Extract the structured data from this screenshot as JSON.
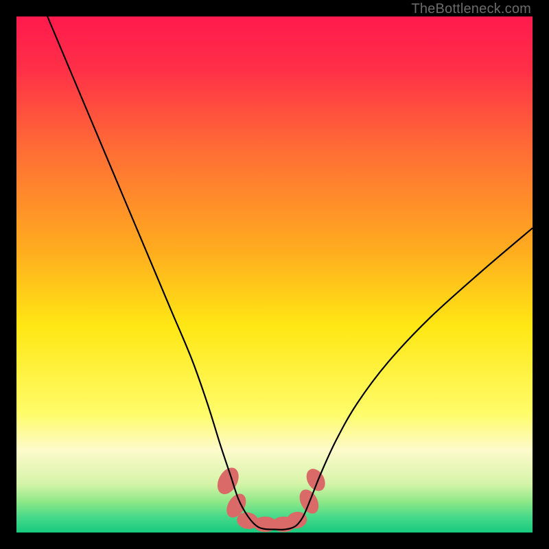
{
  "watermark": "TheBottleneck.com",
  "chart_data": {
    "type": "line",
    "title": "",
    "xlabel": "",
    "ylabel": "",
    "xlim": [
      0,
      100
    ],
    "ylim": [
      0,
      100
    ],
    "background_gradient": {
      "stops": [
        {
          "offset": 0.0,
          "color": "#ff1a4d"
        },
        {
          "offset": 0.1,
          "color": "#ff2f48"
        },
        {
          "offset": 0.25,
          "color": "#ff6a36"
        },
        {
          "offset": 0.45,
          "color": "#ffab1f"
        },
        {
          "offset": 0.6,
          "color": "#ffe714"
        },
        {
          "offset": 0.77,
          "color": "#fffc6a"
        },
        {
          "offset": 0.84,
          "color": "#fdfacb"
        },
        {
          "offset": 0.905,
          "color": "#d6f4a9"
        },
        {
          "offset": 0.94,
          "color": "#8fe887"
        },
        {
          "offset": 0.97,
          "color": "#46d98a"
        },
        {
          "offset": 1.0,
          "color": "#17c97d"
        }
      ]
    },
    "series": [
      {
        "name": "bottleneck-curve",
        "color": "#000000",
        "stroke_width": 2.2,
        "x": [
          6,
          10,
          14,
          18,
          22,
          26,
          30,
          34,
          37,
          39.5,
          41.5,
          43,
          44.8,
          46.5,
          48,
          50,
          52,
          54,
          55.5,
          57,
          59,
          62,
          66,
          72,
          80,
          90,
          100
        ],
        "y": [
          100,
          90.5,
          81,
          71.5,
          62,
          52.5,
          43,
          33.5,
          25,
          17,
          11,
          6.5,
          3.2,
          1.3,
          0.7,
          0.6,
          0.6,
          1.2,
          3.0,
          6.5,
          11.5,
          18,
          25,
          33,
          41.5,
          50.5,
          59
        ]
      }
    ],
    "markers": {
      "name": "highlight-cluster",
      "shape": "rounded-blob",
      "color": "#d96a67",
      "points": [
        {
          "x": 41.0,
          "y": 10.0,
          "w": 3.6,
          "h": 5.5,
          "rot": 28
        },
        {
          "x": 42.6,
          "y": 5.2,
          "w": 3.2,
          "h": 5.0,
          "rot": 30
        },
        {
          "x": 44.8,
          "y": 2.3,
          "w": 4.2,
          "h": 3.2,
          "rot": 10
        },
        {
          "x": 48.2,
          "y": 1.6,
          "w": 4.6,
          "h": 3.0,
          "rot": 0
        },
        {
          "x": 51.8,
          "y": 1.6,
          "w": 4.6,
          "h": 3.0,
          "rot": 0
        },
        {
          "x": 54.3,
          "y": 2.4,
          "w": 4.0,
          "h": 3.2,
          "rot": -12
        },
        {
          "x": 56.7,
          "y": 6.0,
          "w": 3.2,
          "h": 5.0,
          "rot": -28
        },
        {
          "x": 58.0,
          "y": 10.2,
          "w": 3.2,
          "h": 4.6,
          "rot": -30
        }
      ]
    }
  }
}
